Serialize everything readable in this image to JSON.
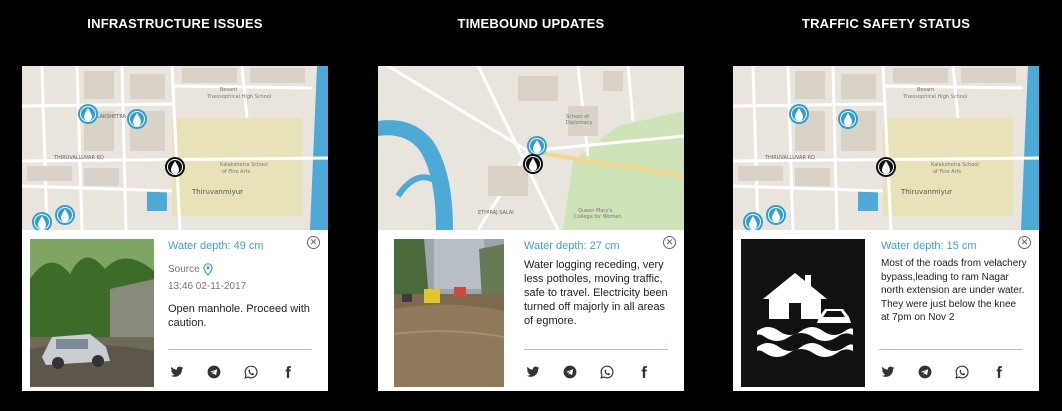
{
  "panels": [
    {
      "title": "INFRASTRUCTURE ISSUES",
      "map_labels": [
        "Besant Theosophical High School",
        "Kalakshetra School of Fine Arts",
        "Thiruvanmiyur",
        "THIRUVALLUVAR RD",
        "KALAKSHETRA RD"
      ],
      "depth": "Water depth: 49 cm",
      "source_label": "Source",
      "timestamp": "13:46 02-11-2017",
      "description": "Open manhole. Proceed with caution.",
      "photo": "flooded-street-car"
    },
    {
      "title": "TIMEBOUND UPDATES",
      "map_labels": [
        "School of Diplomacy",
        "Queen Mary's College for Women",
        "ETHIRAJ SALAI"
      ],
      "depth": "Water depth: 27 cm",
      "description": "Water logging receding, very less potholes, moving traffic, safe to travel. Electricity been turned off majorly in all areas of egmore.",
      "photo": "flooded-road-traffic"
    },
    {
      "title": "TRAFFIC SAFETY STATUS",
      "map_labels": [
        "Besant Theosophical High School",
        "Kalakshetra School of Fine Arts",
        "Thiruvanmiyur",
        "THIRUVALLUVAR RD"
      ],
      "depth": "Water depth: 15 cm",
      "description": "Most of the roads from velachery bypass,leading to ram Nagar north extension are under water. They were just below the knee at 7pm on Nov 2",
      "photo": "flood-house-car-icon"
    }
  ],
  "close_icon": "close-circle-icon",
  "share_icons": [
    "twitter-icon",
    "telegram-icon",
    "whatsapp-icon",
    "facebook-icon"
  ],
  "colors": {
    "accent": "#3ba3cf",
    "marker_blue": "#2f9fd0",
    "marker_black": "#111111",
    "map_bg": "#e9e4dc",
    "park": "#e7e2b8",
    "water": "#4da9d6"
  }
}
